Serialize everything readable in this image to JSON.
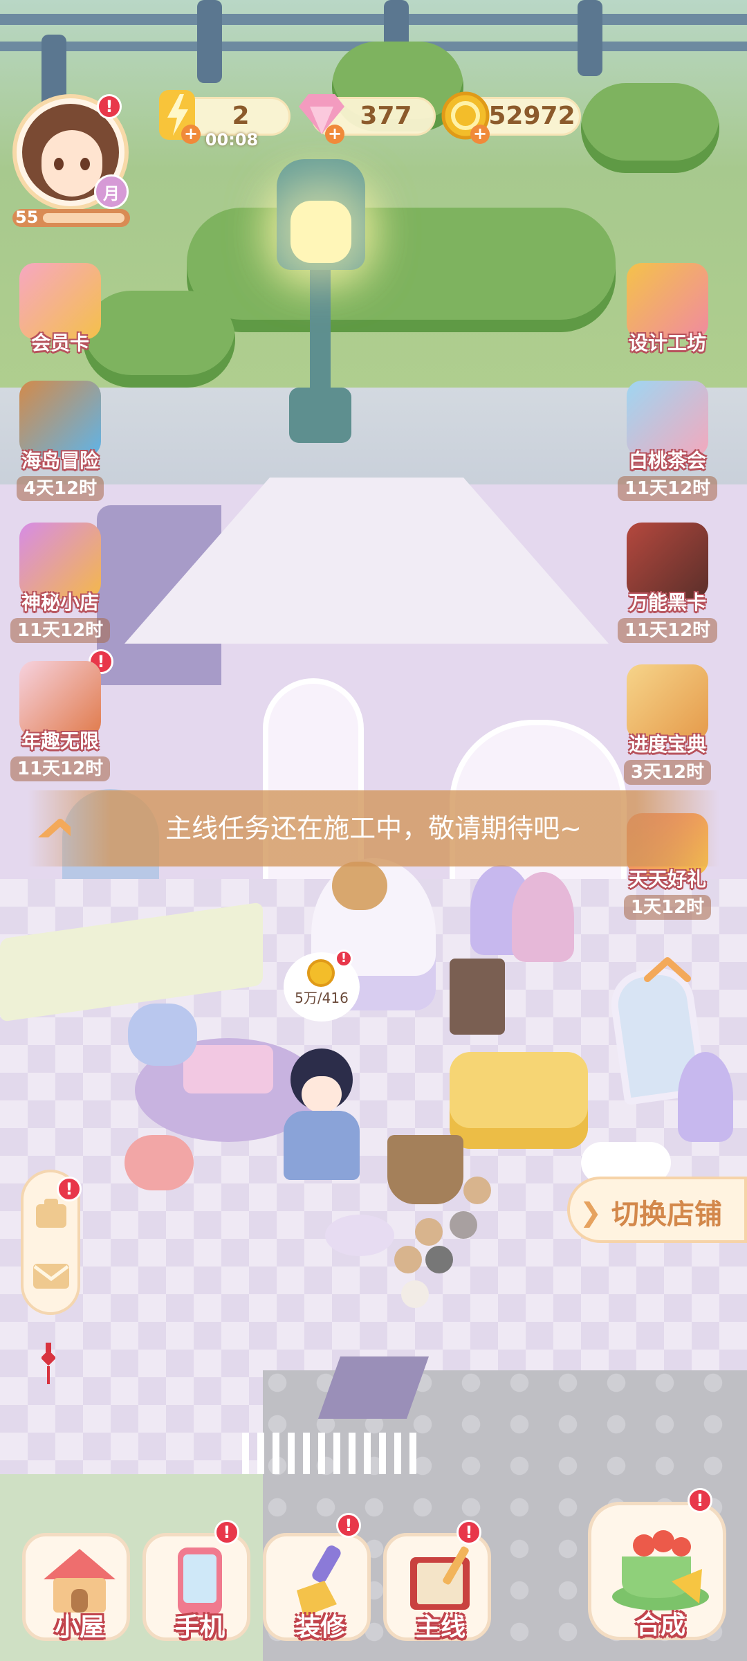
{
  "player": {
    "level": "55",
    "moon_badge": "月"
  },
  "resources": {
    "energy": {
      "value": "2",
      "timer": "00:08"
    },
    "gems": {
      "value": "377"
    },
    "coins": {
      "value": "52972"
    }
  },
  "left_side": [
    {
      "label": "会员卡",
      "timer": "",
      "icon": "vip-card-icon"
    },
    {
      "label": "海岛冒险",
      "timer": "4天12时",
      "icon": "island-boat-icon"
    },
    {
      "label": "神秘小店",
      "timer": "11天12时",
      "icon": "gift-shop-icon"
    },
    {
      "label": "年趣无限",
      "timer": "11天12时",
      "icon": "newyear-cat-icon"
    }
  ],
  "right_side": [
    {
      "label": "设计工坊",
      "timer": "",
      "icon": "pencil-ruler-icon"
    },
    {
      "label": "白桃茶会",
      "timer": "11天12时",
      "icon": "peach-tea-icon"
    },
    {
      "label": "万能黑卡",
      "timer": "11天12时",
      "icon": "black-cards-icon"
    },
    {
      "label": "进度宝典",
      "timer": "3天12时",
      "icon": "progress-book-icon"
    },
    {
      "label": "天天好礼",
      "timer": "1天12时",
      "icon": "daily-gift-icon"
    }
  ],
  "toast": "主线任务还在施工中，敬请期待吧~",
  "coin_bubble": "5万/416",
  "switch_shop": "切换店铺",
  "bottom_nav": [
    {
      "label": "小屋",
      "icon": "house-icon"
    },
    {
      "label": "手机",
      "icon": "phone-icon"
    },
    {
      "label": "装修",
      "icon": "paintbrush-icon"
    },
    {
      "label": "主线",
      "icon": "storybook-icon"
    }
  ],
  "merge_button": {
    "label": "合成",
    "icon": "teacup-merge-icon"
  },
  "badges": {
    "red_dot": "!"
  },
  "colors": {
    "accent": "#e8374a",
    "label_outline": "#c1434c",
    "toast_bg": "#d2965a"
  }
}
